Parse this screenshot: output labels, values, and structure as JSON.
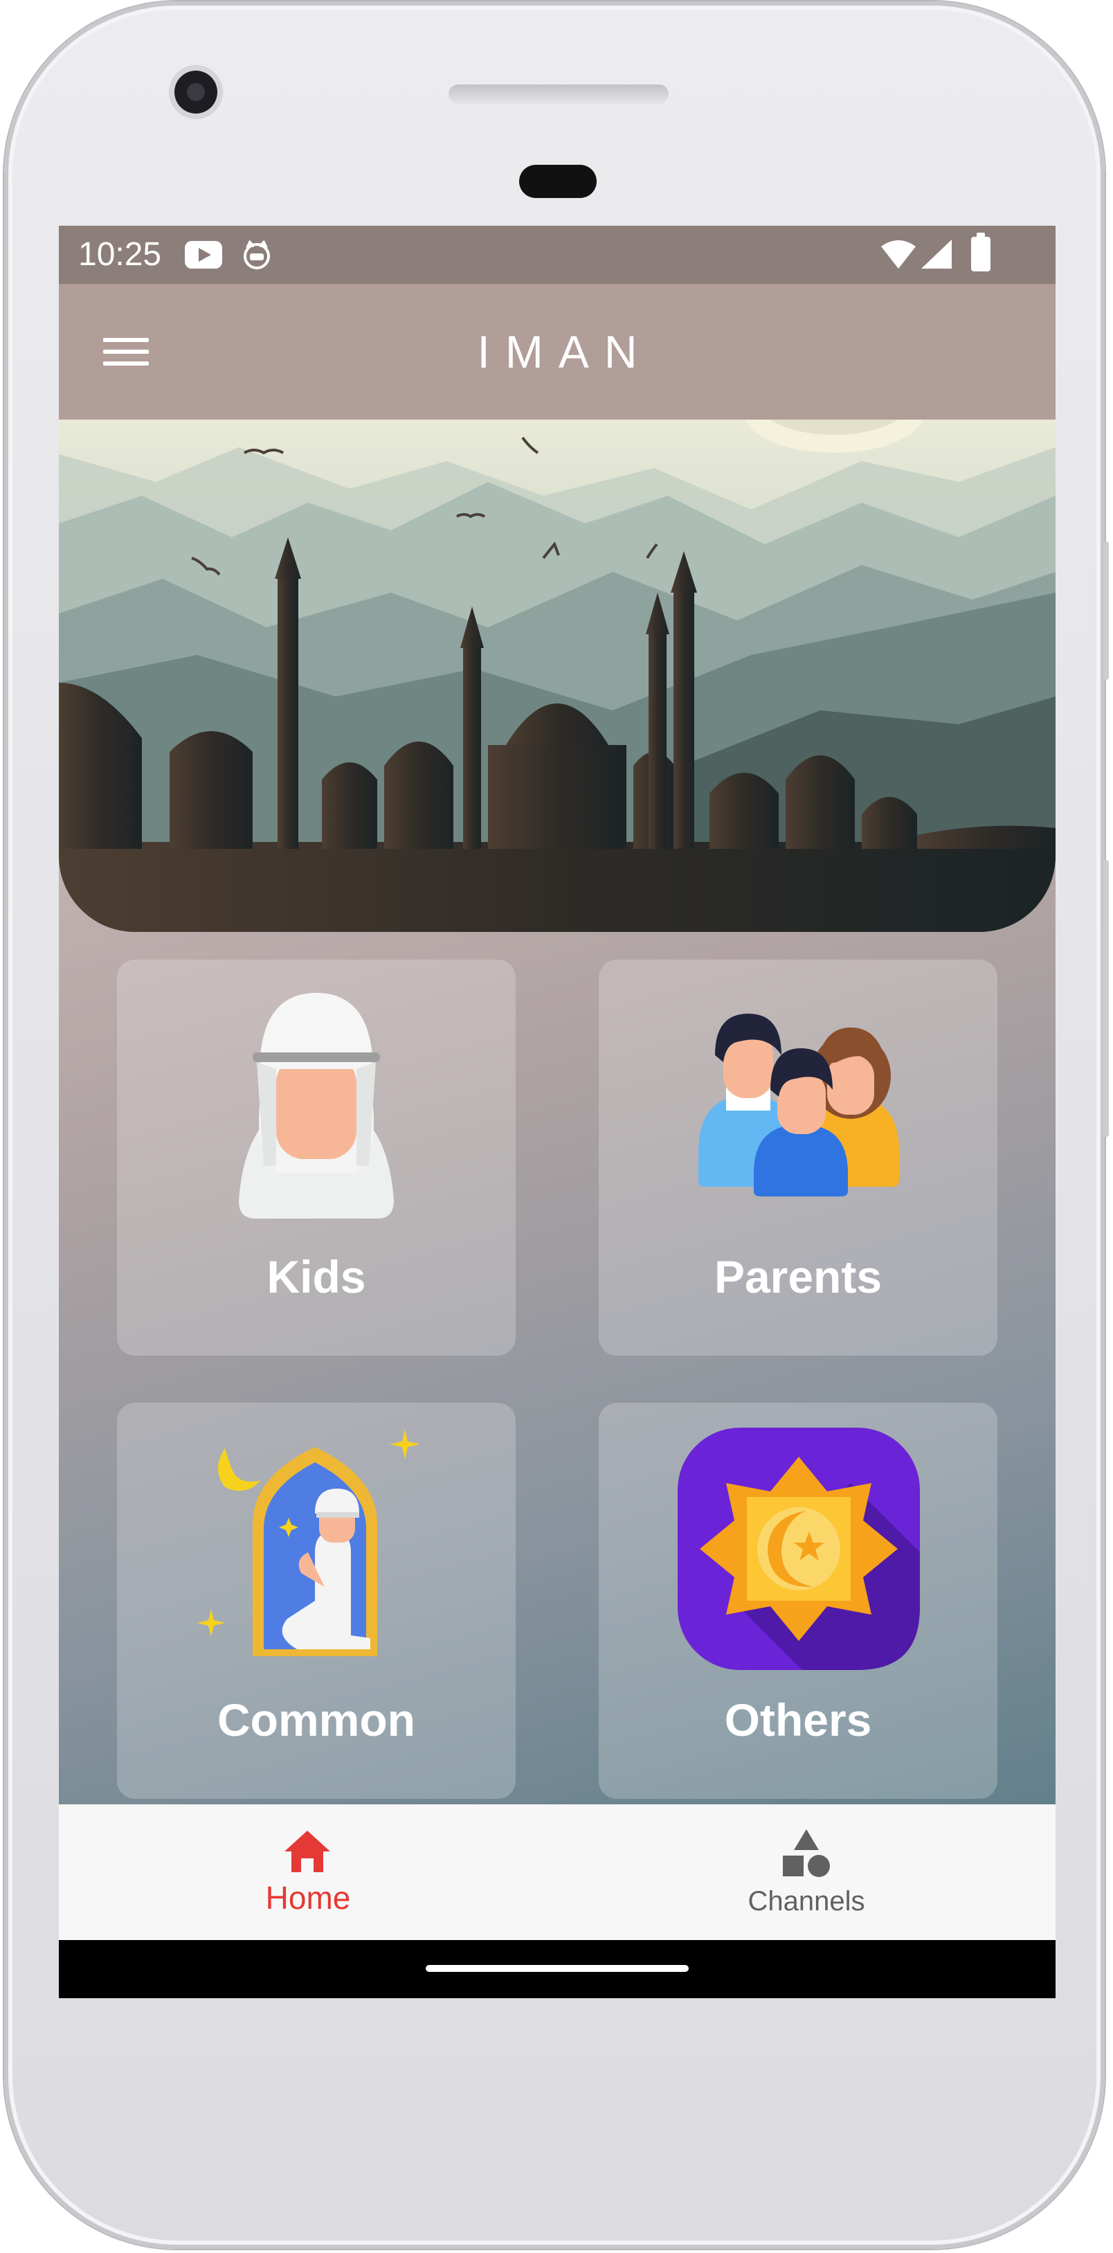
{
  "status_bar": {
    "time": "10:25",
    "icons": [
      "youtube-icon",
      "cat-app-icon",
      "wifi-icon",
      "signal-icon",
      "battery-icon"
    ]
  },
  "app_bar": {
    "title": "IMAN",
    "menu_icon": "hamburger-menu-icon",
    "background": "#b19e98"
  },
  "hero": {
    "image": "mosque-silhouette-mountains-illustration"
  },
  "categories": [
    {
      "label": "Kids",
      "icon": "child-in-keffiyeh-icon"
    },
    {
      "label": "Parents",
      "icon": "family-icon"
    },
    {
      "label": "Common",
      "icon": "praying-person-mihrab-icon"
    },
    {
      "label": "Others",
      "icon": "crescent-star-octagram-icon"
    }
  ],
  "bottom_nav": {
    "items": [
      {
        "label": "Home",
        "icon": "home-icon",
        "active": true
      },
      {
        "label": "Channels",
        "icon": "shapes-icon",
        "active": false
      }
    ],
    "active_color": "#e53935",
    "inactive_color": "#616161"
  }
}
